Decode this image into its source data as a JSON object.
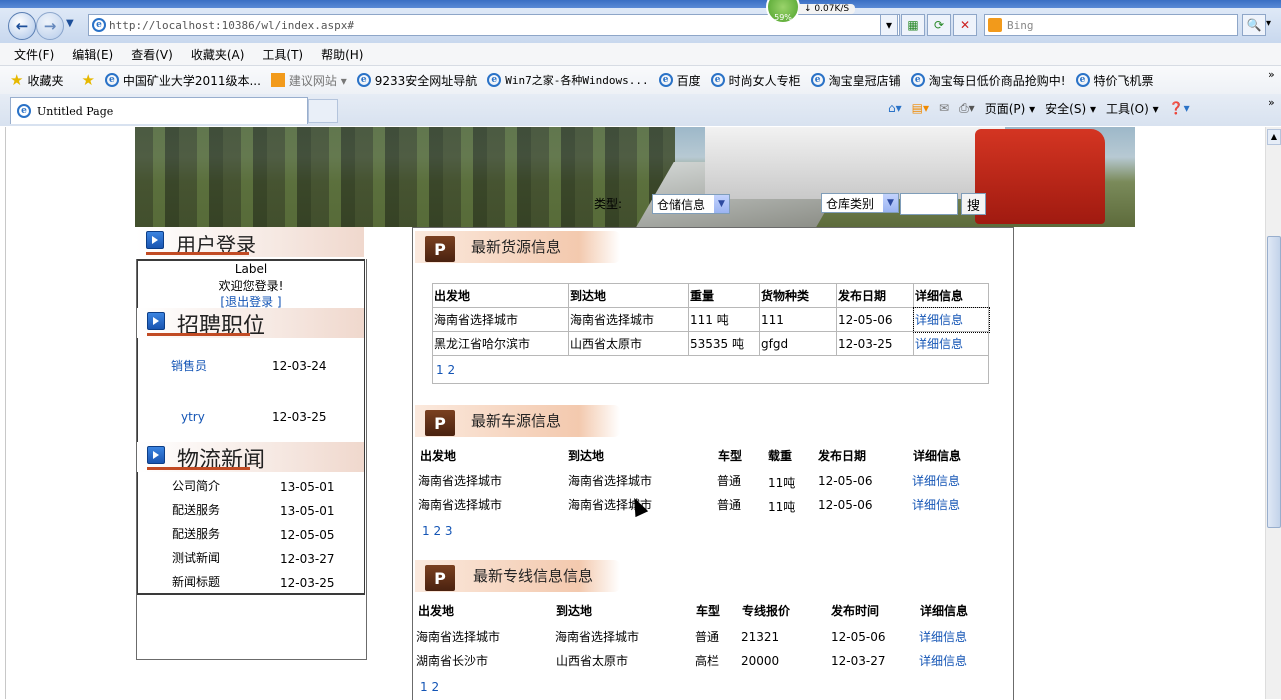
{
  "browser": {
    "url": "http://localhost:10386/wl/index.aspx#",
    "search_engine": "Bing",
    "speed_percent": "59%",
    "speed_rate": "↓ 0.07K/S",
    "menu": [
      "文件(F)",
      "编辑(E)",
      "查看(V)",
      "收藏夹(A)",
      "工具(T)",
      "帮助(H)"
    ],
    "favorites_label": "收藏夹",
    "favorites": [
      "中国矿业大学2011级本...",
      "建议网站 ▾",
      "9233安全网址导航",
      "Win7之家-各种Windows...",
      "百度",
      "时尚女人专柜",
      "淘宝皇冠店铺",
      "淘宝每日低价商品抢购中!",
      "特价飞机票"
    ],
    "tab_title": "Untitled Page",
    "command_bar": [
      "页面(P) ▾",
      "安全(S) ▾",
      "工具(O) ▾"
    ]
  },
  "search": {
    "type_label": "类型:",
    "type_value": "仓储信息",
    "category_value": "仓库类别",
    "button": "搜"
  },
  "login": {
    "title": "用户登录",
    "label": "Label",
    "welcome": "欢迎您登录!",
    "logout": "[退出登录 ]"
  },
  "jobs": {
    "title": "招聘职位",
    "items": [
      {
        "name": "销售员",
        "date": "12-03-24"
      },
      {
        "name": "ytry",
        "date": "12-03-25"
      }
    ]
  },
  "news": {
    "title": "物流新闻",
    "items": [
      {
        "name": "公司简介",
        "date": "13-05-01"
      },
      {
        "name": "配送服务",
        "date": "13-05-01"
      },
      {
        "name": "配送服务",
        "date": "12-05-05"
      },
      {
        "name": "测试新闻",
        "date": "12-03-27"
      },
      {
        "name": "新闻标题",
        "date": "12-03-25"
      }
    ]
  },
  "cargo": {
    "title": "最新货源信息",
    "headers": [
      "出发地",
      "到达地",
      "重量",
      "货物种类",
      "发布日期",
      "详细信息"
    ],
    "rows": [
      [
        "海南省选择城市",
        "海南省选择城市",
        "111 吨",
        "111",
        "12-05-06",
        "详细信息"
      ],
      [
        "黑龙江省哈尔滨市",
        "山西省太原市",
        "53535 吨",
        "gfgd",
        "12-03-25",
        "详细信息"
      ]
    ],
    "pager": "1 2"
  },
  "vehicles": {
    "title": "最新车源信息",
    "headers": [
      "出发地",
      "到达地",
      "车型",
      "载重",
      "发布日期",
      "详细信息"
    ],
    "rows": [
      [
        "海南省选择城市",
        "海南省选择城市",
        "普通",
        "11吨",
        "12-05-06",
        "详细信息"
      ],
      [
        "海南省选择城市",
        "海南省选择城市",
        "普通",
        "11吨",
        "12-05-06",
        "详细信息"
      ]
    ],
    "pager": "1 2 3"
  },
  "lines": {
    "title": "最新专线信息信息",
    "headers": [
      "出发地",
      "到达地",
      "车型",
      "专线报价",
      "发布时间",
      "详细信息"
    ],
    "rows": [
      [
        "海南省选择城市",
        "海南省选择城市",
        "普通",
        "21321",
        "12-05-06",
        "详细信息"
      ],
      [
        "湖南省长沙市",
        "山西省太原市",
        "高栏",
        "20000",
        "12-03-27",
        "详细信息"
      ]
    ],
    "pager": "1 2"
  }
}
